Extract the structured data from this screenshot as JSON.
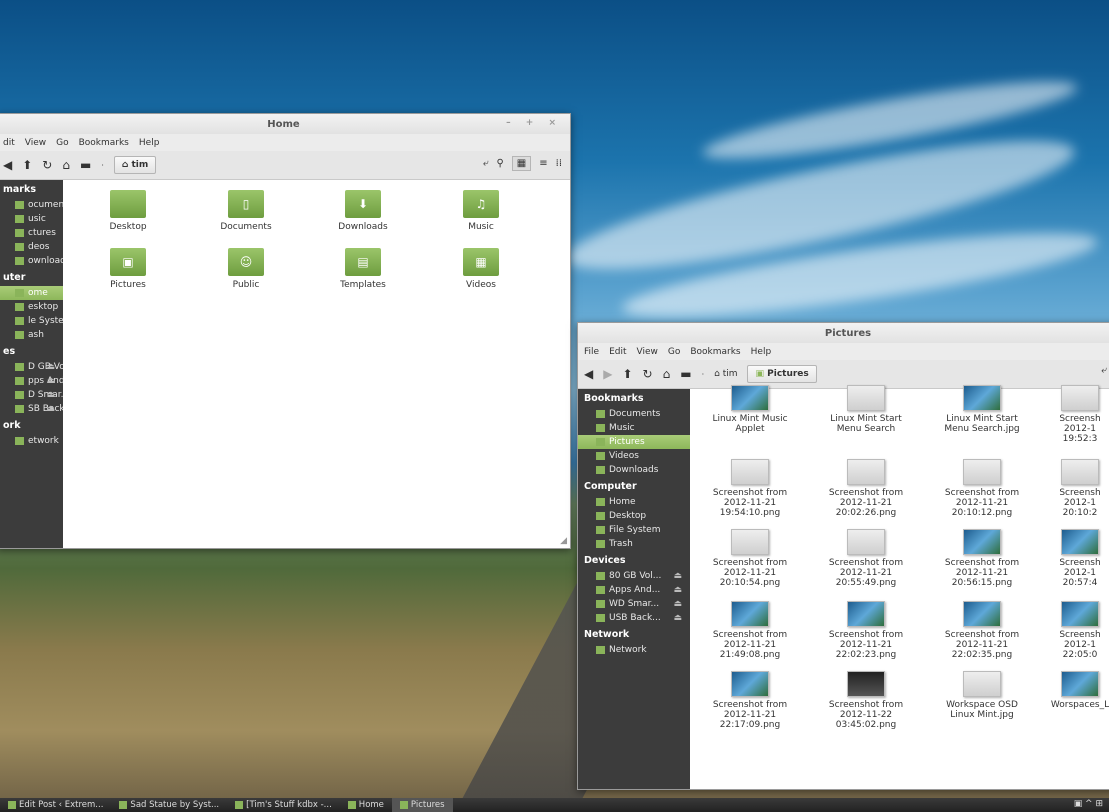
{
  "home_window": {
    "title": "Home",
    "controls": "– + ×",
    "menu": [
      "dit",
      "View",
      "Go",
      "Bookmarks",
      "Help"
    ],
    "breadcrumb": "tim",
    "sidebar": [
      {
        "type": "head",
        "label": "marks"
      },
      {
        "type": "item",
        "label": "ocuments"
      },
      {
        "type": "item",
        "label": "usic"
      },
      {
        "type": "item",
        "label": "ctures"
      },
      {
        "type": "item",
        "label": "deos"
      },
      {
        "type": "item",
        "label": "ownloads"
      },
      {
        "type": "head",
        "label": "uter"
      },
      {
        "type": "item",
        "label": "ome",
        "selected": true
      },
      {
        "type": "item",
        "label": "esktop"
      },
      {
        "type": "item",
        "label": "le System"
      },
      {
        "type": "item",
        "label": "ash"
      },
      {
        "type": "head",
        "label": "es"
      },
      {
        "type": "item",
        "label": "D GB Vol...",
        "eject": true
      },
      {
        "type": "item",
        "label": "pps And...",
        "eject": true
      },
      {
        "type": "item",
        "label": "D Smar...",
        "eject": true
      },
      {
        "type": "item",
        "label": "SB Back...",
        "eject": true
      },
      {
        "type": "head",
        "label": "ork"
      },
      {
        "type": "item",
        "label": "etwork"
      }
    ],
    "folders": [
      {
        "label": "Desktop",
        "icon": "desktop-folder-icon",
        "glyph": ""
      },
      {
        "label": "Documents",
        "icon": "documents-folder-icon",
        "glyph": "▯"
      },
      {
        "label": "Downloads",
        "icon": "downloads-folder-icon",
        "glyph": "⬇"
      },
      {
        "label": "Music",
        "icon": "music-folder-icon",
        "glyph": "♫"
      },
      {
        "label": "Pictures",
        "icon": "pictures-folder-icon",
        "glyph": "▣"
      },
      {
        "label": "Public",
        "icon": "public-folder-icon",
        "glyph": "☺"
      },
      {
        "label": "Templates",
        "icon": "templates-folder-icon",
        "glyph": "▤"
      },
      {
        "label": "Videos",
        "icon": "videos-folder-icon",
        "glyph": "▦"
      }
    ]
  },
  "pictures_window": {
    "title": "Pictures",
    "menu": [
      "File",
      "Edit",
      "View",
      "Go",
      "Bookmarks",
      "Help"
    ],
    "breadcrumb_parent": "tim",
    "breadcrumb_current": "Pictures",
    "sidebar": [
      {
        "type": "head",
        "label": "Bookmarks"
      },
      {
        "type": "item",
        "label": "Documents"
      },
      {
        "type": "item",
        "label": "Music"
      },
      {
        "type": "item",
        "label": "Pictures",
        "selected": true
      },
      {
        "type": "item",
        "label": "Videos"
      },
      {
        "type": "item",
        "label": "Downloads"
      },
      {
        "type": "head",
        "label": "Computer"
      },
      {
        "type": "item",
        "label": "Home"
      },
      {
        "type": "item",
        "label": "Desktop"
      },
      {
        "type": "item",
        "label": "File System"
      },
      {
        "type": "item",
        "label": "Trash"
      },
      {
        "type": "head",
        "label": "Devices"
      },
      {
        "type": "item",
        "label": "80 GB Vol...",
        "eject": true
      },
      {
        "type": "item",
        "label": "Apps And...",
        "eject": true
      },
      {
        "type": "item",
        "label": "WD Smar...",
        "eject": true
      },
      {
        "type": "item",
        "label": "USB Back...",
        "eject": true
      },
      {
        "type": "head",
        "label": "Network"
      },
      {
        "type": "item",
        "label": "Network"
      }
    ],
    "files": [
      {
        "lines": [
          "Linux Mint Music",
          "Applet"
        ],
        "thumb": "t-img"
      },
      {
        "lines": [
          "Linux Mint Start",
          "Menu Search"
        ],
        "thumb": "t-ui"
      },
      {
        "lines": [
          "Linux Mint Start",
          "Menu Search.jpg"
        ],
        "thumb": "t-img"
      },
      {
        "lines": [
          "Screensh",
          "2012-1",
          "19:52:3"
        ],
        "thumb": "t-ui"
      },
      {
        "lines": [
          "Screenshot from",
          "2012-11-21",
          "19:54:10.png"
        ],
        "thumb": "t-ui"
      },
      {
        "lines": [
          "Screenshot from",
          "2012-11-21",
          "20:02:26.png"
        ],
        "thumb": "t-ui"
      },
      {
        "lines": [
          "Screenshot from",
          "2012-11-21",
          "20:10:12.png"
        ],
        "thumb": "t-ui"
      },
      {
        "lines": [
          "Screensh",
          "2012-1",
          "20:10:2"
        ],
        "thumb": "t-ui"
      },
      {
        "lines": [
          "Screenshot from",
          "2012-11-21",
          "20:10:54.png"
        ],
        "thumb": "t-ui"
      },
      {
        "lines": [
          "Screenshot from",
          "2012-11-21",
          "20:55:49.png"
        ],
        "thumb": "t-ui"
      },
      {
        "lines": [
          "Screenshot from",
          "2012-11-21",
          "20:56:15.png"
        ],
        "thumb": "t-img"
      },
      {
        "lines": [
          "Screensh",
          "2012-1",
          "20:57:4"
        ],
        "thumb": "t-img"
      },
      {
        "lines": [
          "Screenshot from",
          "2012-11-21",
          "21:49:08.png"
        ],
        "thumb": "t-img"
      },
      {
        "lines": [
          "Screenshot from",
          "2012-11-21",
          "22:02:23.png"
        ],
        "thumb": "t-img"
      },
      {
        "lines": [
          "Screenshot from",
          "2012-11-21",
          "22:02:35.png"
        ],
        "thumb": "t-img"
      },
      {
        "lines": [
          "Screensh",
          "2012-1",
          "22:05:0"
        ],
        "thumb": "t-img"
      },
      {
        "lines": [
          "Screenshot from",
          "2012-11-21",
          "22:17:09.png"
        ],
        "thumb": "t-img"
      },
      {
        "lines": [
          "Screenshot from",
          "2012-11-22",
          "03:45:02.png"
        ],
        "thumb": "t-dark"
      },
      {
        "lines": [
          "Workspace OSD",
          "Linux Mint.jpg"
        ],
        "thumb": "t-ui"
      },
      {
        "lines": [
          "Worspaces_L"
        ],
        "thumb": "t-img"
      }
    ]
  },
  "taskbar": {
    "items": [
      {
        "label": "Edit Post ‹ Extrem...",
        "active": false
      },
      {
        "label": "Sad Statue by Syst...",
        "active": false
      },
      {
        "label": "[Tim's Stuff kdbx -...",
        "active": false
      },
      {
        "label": "Home",
        "active": false
      },
      {
        "label": "Pictures",
        "active": true
      }
    ],
    "tray": "▣ ^ ⊞"
  },
  "colors": {
    "accent": "#8db75a",
    "sidebar_bg": "#3c3c3c"
  }
}
